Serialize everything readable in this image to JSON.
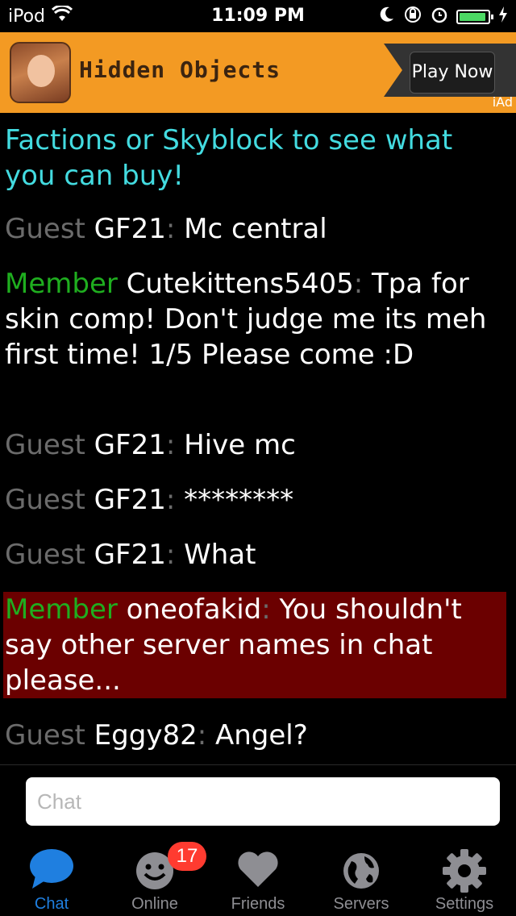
{
  "status_bar": {
    "carrier": "iPod",
    "time": "11:09 PM",
    "icons": [
      "wifi-icon",
      "moon-icon",
      "orientation-lock-icon",
      "alarm-icon",
      "battery-icon",
      "charging-icon"
    ]
  },
  "ad": {
    "title": "Hidden Objects",
    "cta": "Play Now",
    "network": "iAd"
  },
  "messages": [
    {
      "type": "system",
      "text": "Factions or Skyblock to see what you can buy!"
    },
    {
      "rank": "Guest",
      "name": "GF21",
      "sep": ":",
      "text": " Mc central"
    },
    {
      "rank": "Member",
      "name": "Cutekittens5405",
      "sep": ":",
      "text": " Tpa for skin comp! Don't judge me its meh first time! 1/5 Please come :D"
    },
    {
      "rank": "Guest",
      "name": "GF21",
      "sep": ":",
      "text": " Hive mc"
    },
    {
      "rank": "Guest",
      "name": "GF21",
      "sep": ":",
      "text": " ********"
    },
    {
      "rank": "Guest",
      "name": "GF21",
      "sep": ":",
      "text": " What"
    },
    {
      "rank": "Member",
      "name": "oneofakid",
      "sep": ":",
      "text": " You shouldn't say other server names in chat please..."
    },
    {
      "rank": "Guest",
      "name": "Eggy82",
      "sep": ":",
      "text": " Angel?"
    }
  ],
  "chat_input": {
    "placeholder": "Chat",
    "value": ""
  },
  "tabs": [
    {
      "label": "Chat",
      "icon": "chat-bubble-icon",
      "active": true
    },
    {
      "label": "Online",
      "icon": "smiley-icon",
      "badge": "17"
    },
    {
      "label": "Friends",
      "icon": "heart-icon"
    },
    {
      "label": "Servers",
      "icon": "globe-icon"
    },
    {
      "label": "Settings",
      "icon": "gear-icon"
    }
  ],
  "colors": {
    "system_text": "#43dbe0",
    "guest_rank": "#6b6b6b",
    "member_rank": "#1fae1f",
    "highlight_bg": "#6b0000",
    "active_tab": "#1f7fe0",
    "ad_bg": "#f39a23",
    "badge": "#ff3b30"
  }
}
